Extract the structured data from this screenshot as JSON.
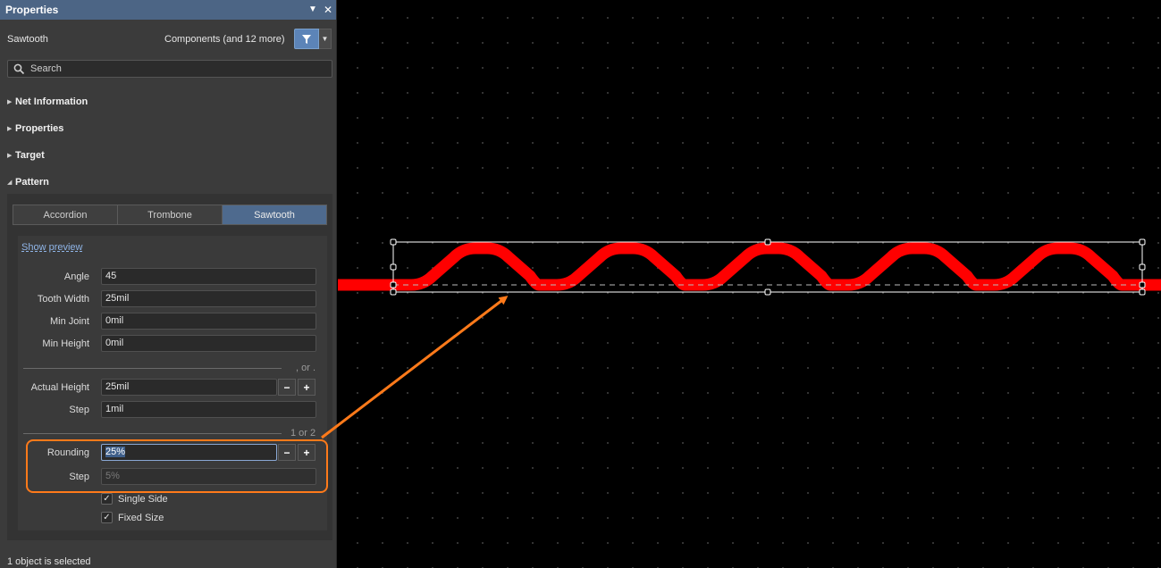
{
  "panel": {
    "title": "Properties",
    "selection_name": "Sawtooth",
    "filter_text": "Components (and 12 more)",
    "search_placeholder": "Search",
    "status": "1 object is selected"
  },
  "sections": {
    "net_information": "Net Information",
    "properties": "Properties",
    "target": "Target",
    "pattern": "Pattern"
  },
  "pattern": {
    "tabs": [
      "Accordion",
      "Trombone",
      "Sawtooth"
    ],
    "active_tab": "Sawtooth",
    "show_preview": "Show preview",
    "angle_label": "Angle",
    "angle_value": "45",
    "tooth_width_label": "Tooth Width",
    "tooth_width_value": "25mil",
    "min_joint_label": "Min Joint",
    "min_joint_value": "0mil",
    "min_height_label": "Min Height",
    "min_height_value": "0mil",
    "or_text": ", or .",
    "actual_height_label": "Actual Height",
    "actual_height_value": "25mil",
    "step1_label": "Step",
    "step1_value": "1mil",
    "one_or_two": "1 or 2",
    "rounding_label": "Rounding",
    "rounding_value": "25%",
    "step2_label": "Step",
    "step2_value": "5%",
    "single_side_label": "Single Side",
    "single_side_checked": true,
    "fixed_size_label": "Fixed Size",
    "fixed_size_checked": true
  },
  "colors": {
    "trace": "#ff0000",
    "accent": "#5c84b8",
    "annotation": "#ff7a1a",
    "titlebar": "#4c6585"
  },
  "icons": {
    "dropdown": "chevron-down-icon",
    "close": "close-icon",
    "filter": "filter-icon",
    "search": "search-icon"
  }
}
